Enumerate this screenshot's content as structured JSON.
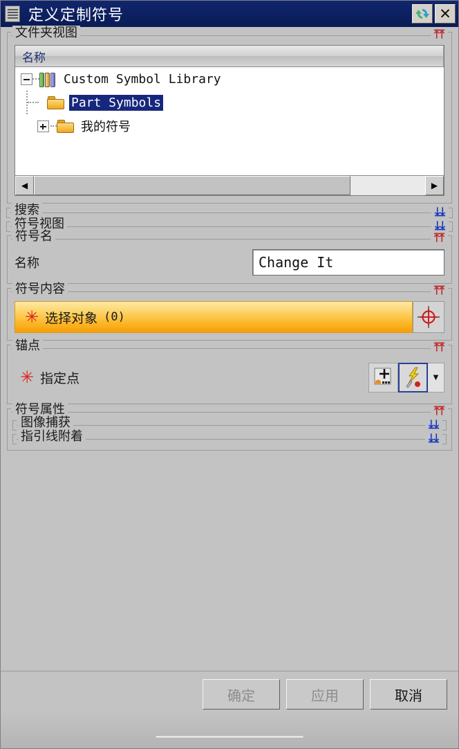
{
  "window": {
    "title": "定义定制符号",
    "menu_icon": "hamburger-menu-icon",
    "reset_icon": "reset-refresh-icon",
    "close_label": "✕"
  },
  "folder_view": {
    "title": "文件夹视图",
    "collapse_chevron": "▲▲",
    "column_header": "名称",
    "tree": [
      {
        "label": "Custom Symbol Library",
        "icon": "books-icon",
        "expander": "minus",
        "selected": false,
        "indent": 0,
        "cjk": false
      },
      {
        "label": "Part Symbols",
        "icon": "folder-icon",
        "expander": "none",
        "selected": true,
        "indent": 1,
        "cjk": false
      },
      {
        "label": "我的符号",
        "icon": "folder-icon",
        "expander": "plus",
        "selected": false,
        "indent": 0,
        "cjk": true
      }
    ],
    "scrollbar": {
      "left_arrow": "◀",
      "right_arrow": "▶",
      "thumb_percent": 81
    }
  },
  "search": {
    "title": "搜索",
    "expand_chevron": "▼▼"
  },
  "symbol_view": {
    "title": "符号视图",
    "expand_chevron": "▼▼"
  },
  "symbol_name": {
    "title": "符号名",
    "collapse_chevron": "▲▲",
    "name_label": "名称",
    "name_value": "Change It",
    "name_placeholder": "Change It"
  },
  "symbol_content": {
    "title": "符号内容",
    "collapse_chevron": "▲▲",
    "required_marker": "✳",
    "select_objects_label": "选择对象",
    "select_objects_count": "(0)",
    "select_icon": "crosshair-target-icon"
  },
  "anchor_point": {
    "title": "锚点",
    "collapse_chevron": "▲▲",
    "required_marker": "✳",
    "specify_point_label": "指定点",
    "point_constructor_icon": "point-constructor-icon",
    "snap_point_icon": "snap-point-lightning-icon",
    "dropdown_arrow": "▼"
  },
  "symbol_attributes": {
    "title": "符号属性",
    "collapse_chevron": "▲▲",
    "subsections": [
      {
        "title": "图像捕获",
        "expand_chevron": "▼▼"
      },
      {
        "title": "指引线附着",
        "expand_chevron": "▼▼"
      }
    ]
  },
  "footer": {
    "ok_label": "确定",
    "apply_label": "应用",
    "cancel_label": "取消"
  },
  "colors": {
    "titlebar": "#0d2060",
    "panel": "#c3c3c3",
    "selection": "#16277c",
    "required_orange": "#fbb524",
    "required_red": "#e02020",
    "chevron_collapse": "#c02a2a",
    "chevron_expand": "#1836c0",
    "accent_border": "#2b3f96"
  }
}
